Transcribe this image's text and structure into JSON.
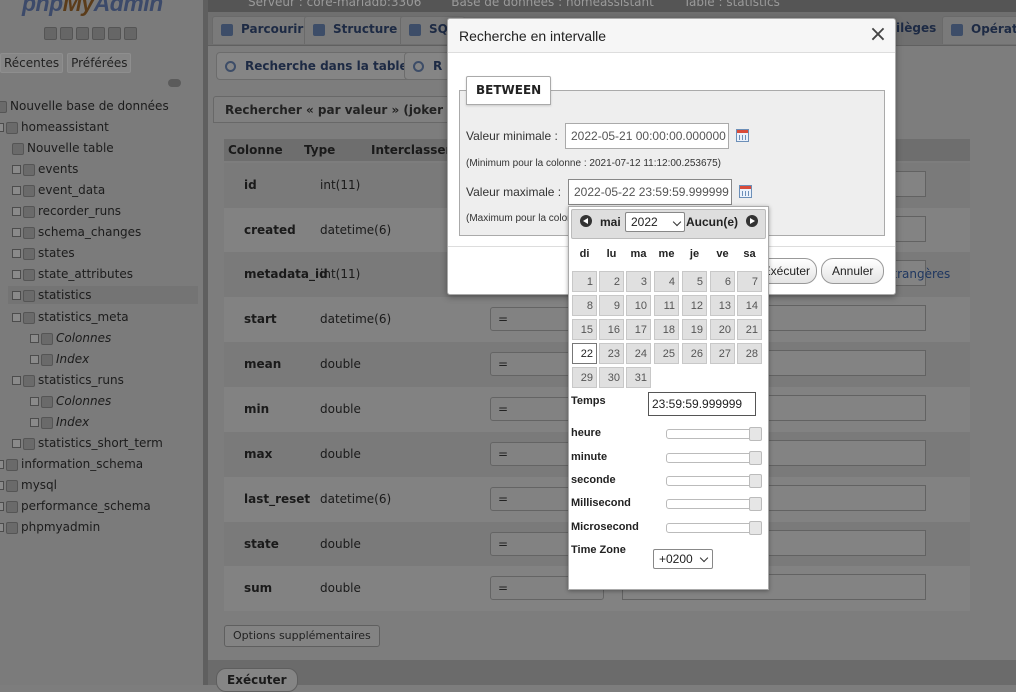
{
  "nav": {
    "logo_php": "php",
    "logo_my": "My",
    "logo_admin": "Admin",
    "tabs": [
      "Récentes",
      "Préférées"
    ],
    "tree": [
      {
        "label": "Nouvelle base de données",
        "indent": 0
      },
      {
        "label": "homeassistant",
        "indent": 0
      },
      {
        "label": "Nouvelle table",
        "indent": 1
      },
      {
        "label": "events",
        "indent": 1
      },
      {
        "label": "event_data",
        "indent": 1
      },
      {
        "label": "recorder_runs",
        "indent": 1
      },
      {
        "label": "schema_changes",
        "indent": 1
      },
      {
        "label": "states",
        "indent": 1
      },
      {
        "label": "state_attributes",
        "indent": 1
      },
      {
        "label": "statistics",
        "indent": 1
      },
      {
        "label": "statistics_meta",
        "indent": 1
      },
      {
        "label": "Colonnes",
        "indent": 2
      },
      {
        "label": "Index",
        "indent": 2
      },
      {
        "label": "statistics_runs",
        "indent": 1
      },
      {
        "label": "Colonnes",
        "indent": 2
      },
      {
        "label": "Index",
        "indent": 2
      },
      {
        "label": "statistics_short_term",
        "indent": 1
      },
      {
        "label": "information_schema",
        "indent": 0
      },
      {
        "label": "mysql",
        "indent": 0
      },
      {
        "label": "performance_schema",
        "indent": 0
      },
      {
        "label": "phpmyadmin",
        "indent": 0
      }
    ]
  },
  "breadcrumb": [
    "Serveur : core-mariadb:3306",
    "Base de données : homeassistant",
    "Table : statistics"
  ],
  "tabs": {
    "browse": "Parcourir",
    "structure": "Structure",
    "sql": "SQL",
    "privileges": "ilèges",
    "operations": "Opérati"
  },
  "subnav": {
    "search": "Recherche dans la table",
    "partial": "R"
  },
  "search_panel": {
    "header": "Rechercher « par valeur » (joker : « % »)",
    "columns": [
      "Colonne",
      "Type",
      "Interclasseme"
    ],
    "rows": [
      {
        "name": "id",
        "type": "int(11)",
        "op": ""
      },
      {
        "name": "created",
        "type": "datetime(6)",
        "op": ""
      },
      {
        "name": "metadata_id",
        "type": "int(11)",
        "op": ""
      },
      {
        "name": "start",
        "type": "datetime(6)",
        "op": "="
      },
      {
        "name": "mean",
        "type": "double",
        "op": "="
      },
      {
        "name": "min",
        "type": "double",
        "op": "="
      },
      {
        "name": "max",
        "type": "double",
        "op": "="
      },
      {
        "name": "last_reset",
        "type": "datetime(6)",
        "op": "="
      },
      {
        "name": "state",
        "type": "double",
        "op": "="
      },
      {
        "name": "sum",
        "type": "double",
        "op": "="
      }
    ],
    "fk_link": "rs étrangères",
    "options_btn": "Options supplémentaires",
    "execute": "Exécuter"
  },
  "dialog": {
    "title": "Recherche en intervalle",
    "close": "×",
    "legend": "BETWEEN",
    "min_label": "Valeur minimale :",
    "min_value": "2022-05-21 00:00:00.000000",
    "min_hint": "(Minimum pour la colonne : 2021-07-12 11:12:00.253675)",
    "max_label": "Valeur maximale :",
    "max_value": "2022-05-22 23:59:59.999999",
    "max_hint": "(Maximum pour la colon",
    "execute": "Exécuter",
    "cancel": "Annuler"
  },
  "datepicker": {
    "month": "mai",
    "year": "2022",
    "none": "Aucun(e)",
    "weekdays": [
      "di",
      "lu",
      "ma",
      "me",
      "je",
      "ve",
      "sa"
    ],
    "selected_day": 22,
    "days_in_month": 31,
    "first_weekday_index": 0,
    "time_label": "Temps",
    "time_value": "23:59:59.999999",
    "hour_label": "heure",
    "minute_label": "minute",
    "second_label": "seconde",
    "millisecond_label": "Millisecond",
    "microsecond_label": "Microsecond",
    "timezone_label": "Time Zone",
    "timezone_value": "+0200",
    "slider_levels": {
      "hour": 1.0,
      "minute": 1.0,
      "second": 1.0,
      "millisecond": 1.0,
      "microsecond": 1.0
    }
  },
  "colors": {
    "overlay_dim": "#7d7d7d",
    "dialog_bg": "#ffffff",
    "accent": "#1f3760"
  }
}
